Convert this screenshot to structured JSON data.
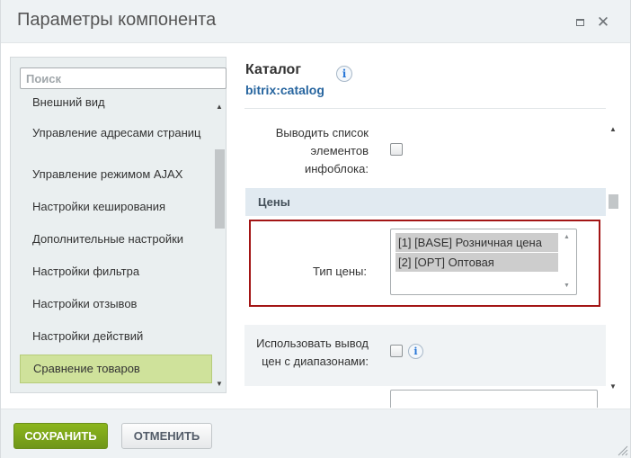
{
  "dialog": {
    "title": "Параметры компонента"
  },
  "left": {
    "search_placeholder": "Поиск",
    "items": [
      {
        "label": "Внешний вид"
      },
      {
        "label": "Управление адресами страниц"
      },
      {
        "label": "Управление режимом AJAX"
      },
      {
        "label": "Настройки кеширования"
      },
      {
        "label": "Дополнительные настройки"
      },
      {
        "label": "Настройки фильтра"
      },
      {
        "label": "Настройки отзывов"
      },
      {
        "label": "Настройки действий"
      },
      {
        "label": "Сравнение товаров",
        "active": true
      }
    ]
  },
  "right": {
    "title": "Каталог",
    "subtitle": "bitrix:catalog",
    "rows": {
      "list_elements_label": "Выводить список элементов инфоблока:",
      "list_elements_checked": false,
      "prices_section": "Цены",
      "price_type_label": "Тип цены:",
      "price_type_options": [
        "[1] [BASE] Розничная цена",
        "[2] [OPT] Оптовая"
      ],
      "use_ranges_label": "Использовать вывод цен с диапазонами:",
      "use_ranges_checked": false
    }
  },
  "footer": {
    "save_label": "СОХРАНИТЬ",
    "cancel_label": "ОТМЕНИТЬ"
  },
  "colors": {
    "accent_green": "#7aa21c",
    "active_item": "#cfe29b",
    "highlight_border": "#a31515",
    "link_blue": "#27659f"
  }
}
